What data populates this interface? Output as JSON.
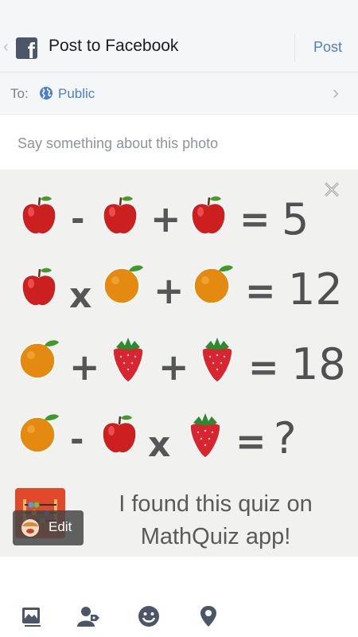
{
  "header": {
    "title": "Post to Facebook",
    "post_label": "Post"
  },
  "audience": {
    "to_label": "To:",
    "value": "Public"
  },
  "composer": {
    "placeholder": "Say something about this photo"
  },
  "photo": {
    "equations": [
      {
        "terms": [
          "apple",
          "-",
          "apple",
          "+",
          "apple"
        ],
        "result": "5"
      },
      {
        "terms": [
          "apple",
          "x",
          "orange",
          "+",
          "orange"
        ],
        "result": "12"
      },
      {
        "terms": [
          "orange",
          "+",
          "strawberry",
          "+",
          "strawberry"
        ],
        "result": "18"
      },
      {
        "terms": [
          "orange",
          "-",
          "apple",
          "x",
          "strawberry"
        ],
        "result": "?"
      }
    ],
    "caption_line1": "I found this quiz on",
    "caption_line2": "MathQuiz app!",
    "edit_label": "Edit"
  },
  "toolbar": {
    "icons": [
      "photo-icon",
      "tag-people-icon",
      "feeling-icon",
      "location-icon"
    ]
  },
  "colors": {
    "accent": "#4a7fd0",
    "apple": "#cc1f1f",
    "orange": "#e48a10",
    "strawberry": "#d8252f"
  }
}
